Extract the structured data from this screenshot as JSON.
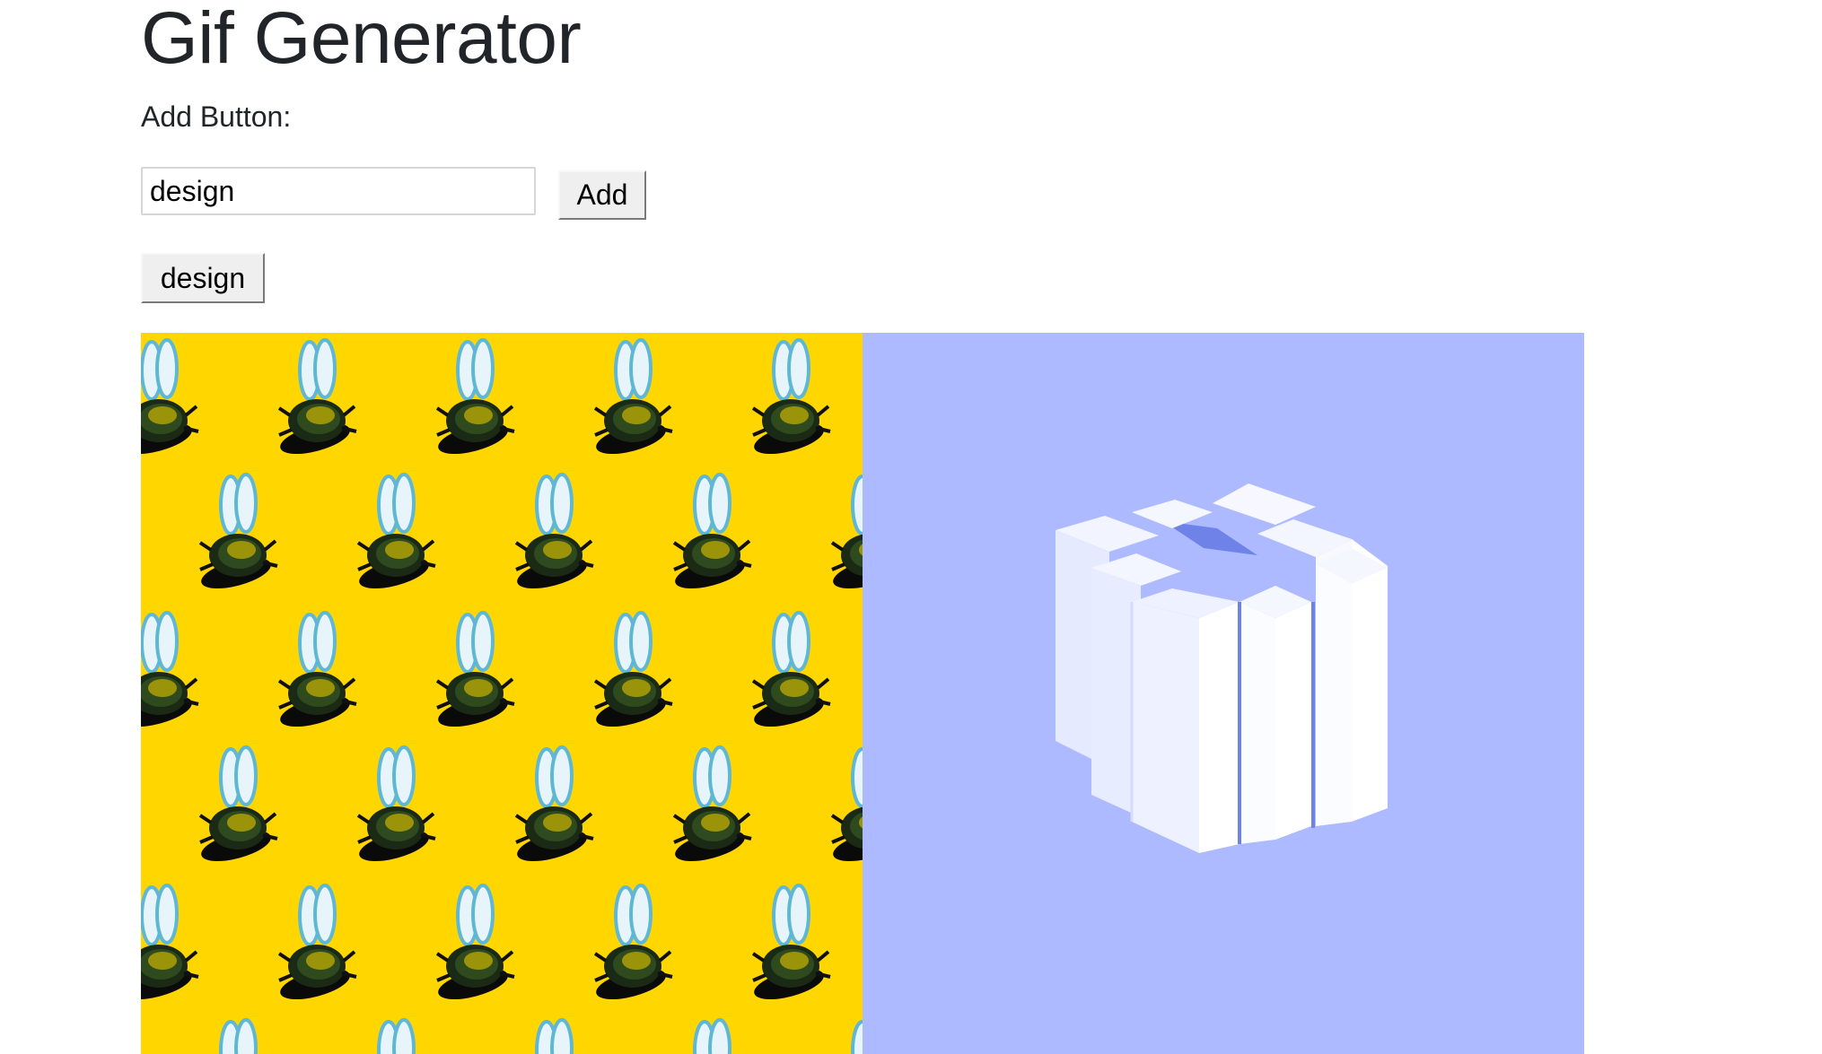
{
  "page": {
    "title": "Gif Generator",
    "add_label": "Add Button:"
  },
  "form": {
    "input_value": "design",
    "add_button": "Add"
  },
  "topic_buttons": [
    {
      "label": "design"
    }
  ],
  "gifs": [
    {
      "background": "#ffd600",
      "motif": "bee-pattern"
    },
    {
      "background": "#adbaff",
      "motif": "white-block-cube"
    }
  ]
}
